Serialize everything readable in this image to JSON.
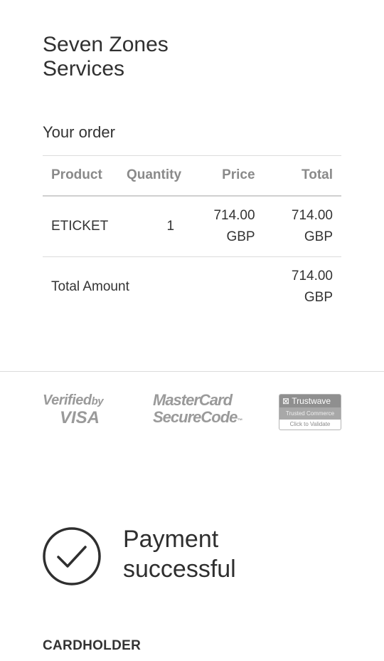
{
  "merchant": {
    "name_line1": "Seven Zones",
    "name_line2": "Services"
  },
  "order": {
    "title": "Your order",
    "columns": {
      "product": "Product",
      "quantity": "Quantity",
      "price": "Price",
      "total": "Total"
    },
    "items": [
      {
        "product": "ETICKET",
        "quantity": "1",
        "price_amount": "714.00",
        "price_currency": "GBP",
        "total_amount": "714.00",
        "total_currency": "GBP"
      }
    ],
    "total_label": "Total Amount",
    "total_amount": "714.00",
    "total_currency": "GBP"
  },
  "security_badges": {
    "visa": {
      "line1": "Verified",
      "by": "by",
      "line2": "VISA",
      "icon": "verified-by-visa-logo"
    },
    "mastercard": {
      "line1": "MasterCard",
      "line2": "SecureCode",
      "tm": "™",
      "icon": "mastercard-securecode-logo"
    },
    "trustwave": {
      "line1": "Trustwave",
      "line2": "Trusted Commerce",
      "line3": "Click to Validate",
      "icon": "trustwave-seal"
    }
  },
  "status": {
    "icon": "check-circle-icon",
    "line1": "Payment",
    "line2": "successful"
  },
  "cardholder": {
    "label": "CARDHOLDER"
  },
  "colors": {
    "text": "#333333",
    "header_text": "#8a8a8a",
    "divider": "#dcdcdc",
    "badge_gray": "#9a9a9a"
  }
}
